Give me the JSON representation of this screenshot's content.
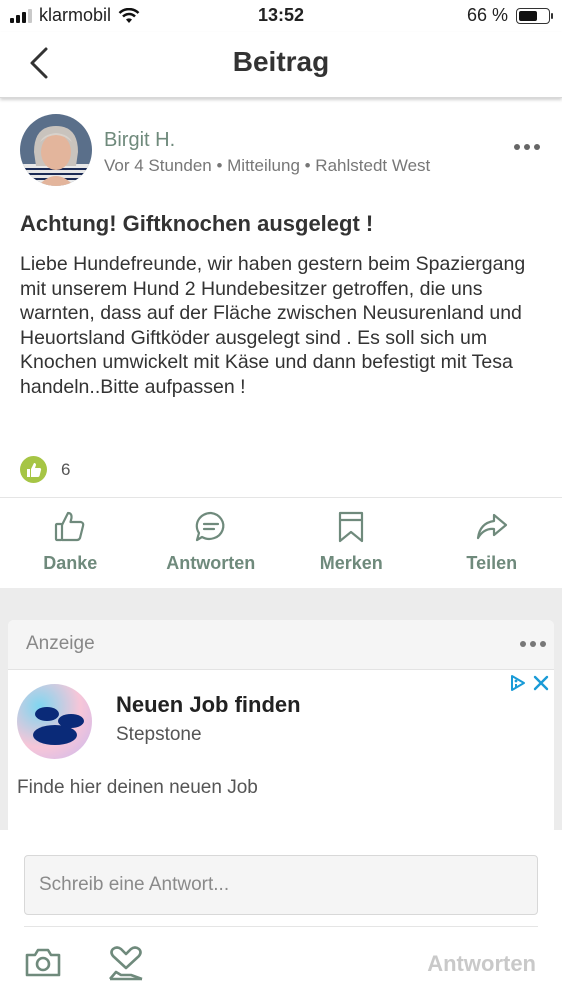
{
  "status_bar": {
    "carrier": "klarmobil",
    "time": "13:52",
    "battery": "66 %",
    "battery_level": 0.66
  },
  "header": {
    "title": "Beitrag"
  },
  "post": {
    "author": "Birgit H.",
    "meta": "Vor 4 Stunden • Mitteilung • Rahlstedt West",
    "title": "Achtung! Giftknochen ausgelegt !",
    "body": "Liebe Hundefreunde, wir haben gestern beim Spaziergang mit unserem Hund 2 Hundebesitzer getroffen, die uns warnten, dass auf der Fläche zwischen Neusurenland und Heuortsland Giftköder ausgelegt sind . Es soll sich um Knochen umwickelt mit Käse und dann befestigt mit Tesa  handeln..Bitte aufpassen !",
    "like_count": "6"
  },
  "actions": [
    {
      "label": "Danke",
      "icon": "thumbs-up-icon"
    },
    {
      "label": "Antworten",
      "icon": "chat-bubble-icon"
    },
    {
      "label": "Merken",
      "icon": "bookmark-icon"
    },
    {
      "label": "Teilen",
      "icon": "share-arrow-icon"
    }
  ],
  "ad": {
    "label": "Anzeige",
    "title": "Neuen Job finden",
    "advertiser": "Stepstone",
    "description": "Finde hier deinen neuen Job"
  },
  "composer": {
    "placeholder": "Schreib eine Antwort...",
    "send_label": "Antworten"
  },
  "colors": {
    "accent": "#6f8a7c",
    "like": "#a6c545",
    "disabled": "#c9c9c9"
  }
}
